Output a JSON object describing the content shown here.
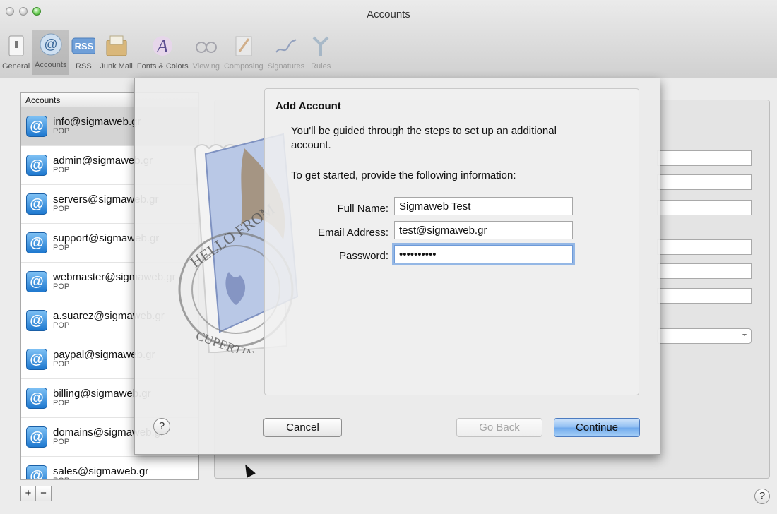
{
  "window": {
    "title": "Accounts"
  },
  "toolbar": {
    "items": [
      {
        "label": "General",
        "icon": "switch-icon"
      },
      {
        "label": "Accounts",
        "icon": "at-sign-icon"
      },
      {
        "label": "RSS",
        "icon": "rss-icon"
      },
      {
        "label": "Junk Mail",
        "icon": "junk-mail-icon"
      },
      {
        "label": "Fonts & Colors",
        "icon": "fonts-colors-icon"
      },
      {
        "label": "Viewing",
        "icon": "glasses-icon"
      },
      {
        "label": "Composing",
        "icon": "pencil-icon"
      },
      {
        "label": "Signatures",
        "icon": "signature-pen-icon"
      },
      {
        "label": "Rules",
        "icon": "rules-icon"
      }
    ],
    "selected": "Accounts"
  },
  "accounts": {
    "header": "Accounts",
    "items": [
      {
        "name": "info@sigmaweb.gr",
        "type": "POP"
      },
      {
        "name": "admin@sigmaweb.gr",
        "type": "POP"
      },
      {
        "name": "servers@sigmaweb.gr",
        "type": "POP"
      },
      {
        "name": "support@sigmaweb.gr",
        "type": "POP"
      },
      {
        "name": "webmaster@sigmaweb.gr",
        "type": "POP"
      },
      {
        "name": "a.suarez@sigmaweb.gr",
        "type": "POP"
      },
      {
        "name": "paypal@sigmaweb.gr",
        "type": "POP"
      },
      {
        "name": "billing@sigmaweb.gr",
        "type": "POP"
      },
      {
        "name": "domains@sigmaweb.gr",
        "type": "POP"
      },
      {
        "name": "sales@sigmaweb.gr",
        "type": "POP"
      }
    ],
    "add_label": "+",
    "remove_label": "−"
  },
  "sheet": {
    "title": "Add Account",
    "intro": "You'll be guided through the steps to set up an additional account.",
    "prompt": "To get started, provide the following information:",
    "fields": {
      "full_name": {
        "label": "Full Name:",
        "value": "Sigmaweb Test"
      },
      "email": {
        "label": "Email Address:",
        "value": "test@sigmaweb.gr"
      },
      "password": {
        "label": "Password:",
        "value": "••••••••••"
      }
    },
    "stamp_text": {
      "top": "HELLO FROM",
      "bottom": "CUPERTINO, CA"
    },
    "help_label": "?",
    "cancel_label": "Cancel",
    "back_label": "Go Back",
    "continue_label": "Continue"
  },
  "help_label": "?",
  "colors": {
    "accent": "#6ea9ec",
    "at_icon": "#1e78cf"
  }
}
